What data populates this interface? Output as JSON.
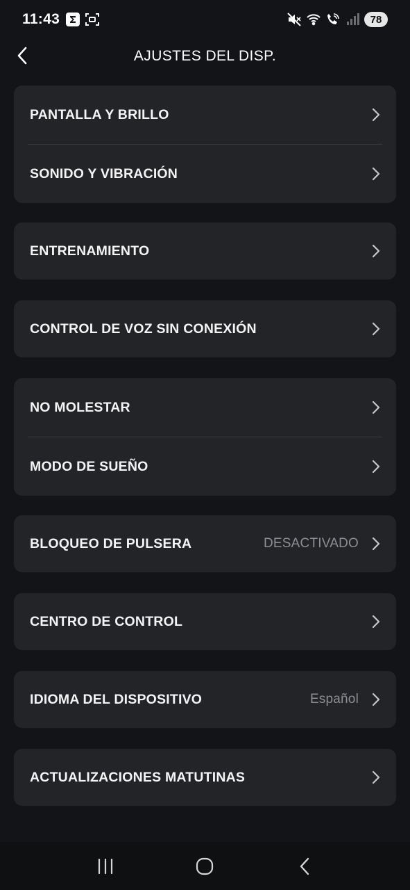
{
  "status_bar": {
    "time": "11:43",
    "battery": "78",
    "icons": [
      "sigma-app-icon",
      "screenshot-icon",
      "mute-icon",
      "wifi-icon",
      "wifi-call-icon",
      "signal-icon"
    ]
  },
  "header": {
    "title": "AJUSTES DEL DISP.",
    "back_icon": "chevron-left-icon"
  },
  "groups": [
    {
      "items": [
        {
          "label": "PANTALLA Y BRILLO"
        },
        {
          "label": "SONIDO Y VIBRACIÓN"
        }
      ]
    },
    {
      "items": [
        {
          "label": "ENTRENAMIENTO"
        }
      ]
    },
    {
      "items": [
        {
          "label": "CONTROL DE VOZ SIN CONEXIÓN"
        }
      ]
    },
    {
      "items": [
        {
          "label": "NO MOLESTAR"
        },
        {
          "label": "MODO DE SUEÑO"
        }
      ]
    },
    {
      "items": [
        {
          "label": "BLOQUEO DE PULSERA",
          "value": "DESACTIVADO"
        }
      ]
    },
    {
      "items": [
        {
          "label": "CENTRO DE CONTROL"
        }
      ]
    },
    {
      "items": [
        {
          "label": "IDIOMA DEL DISPOSITIVO",
          "value": "Español"
        }
      ]
    },
    {
      "items": [
        {
          "label": "ACTUALIZACIONES MATUTINAS"
        }
      ]
    }
  ],
  "nav_bar": {
    "buttons": [
      "recent-apps-icon",
      "home-icon",
      "back-icon"
    ]
  },
  "colors": {
    "background": "#131417",
    "card": "#232428",
    "text": "#f4f4f4",
    "secondary_text": "#8d8e93"
  }
}
